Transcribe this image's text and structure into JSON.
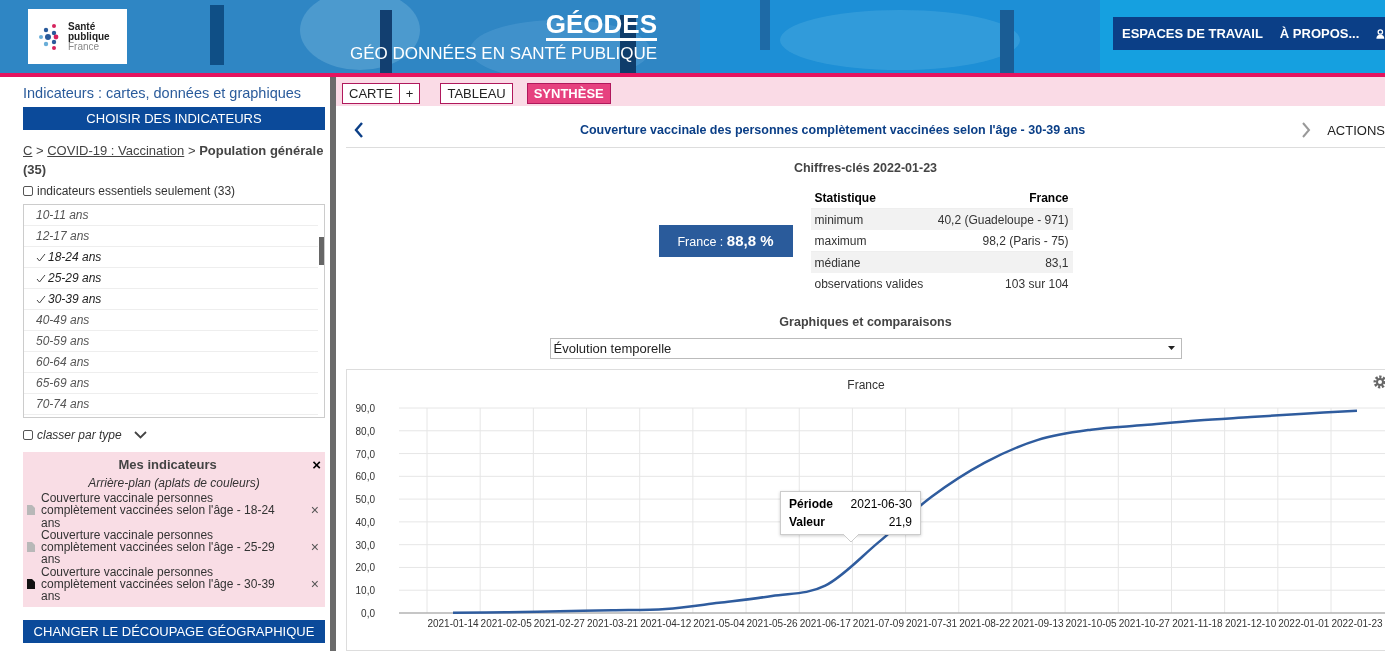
{
  "header": {
    "logo": {
      "line_1": "Santé",
      "line_2": "publique",
      "line_3": "France"
    },
    "title": "GÉODES",
    "subtitle": "GÉO DONNÉES EN SANTÉ PUBLIQUE",
    "nav": [
      "ESPACES DE TRAVAIL",
      "À PROPOS..."
    ],
    "background": {
      "kind": "picture"
    }
  },
  "sidebar": {
    "title": "Indicateurs : cartes, données et graphiques",
    "choose_button": "CHOISIR DES INDICATEURS",
    "breadcrumb": {
      "links": [
        "C",
        "COVID-19 : Vaccination"
      ],
      "separator": ">",
      "current": "Population générale",
      "count": "(35)"
    },
    "essential_filter": {
      "label": "indicateurs essentiels seulement (33)",
      "checked": false
    },
    "items": [
      {
        "label": "10-11 ans",
        "checked": false
      },
      {
        "label": "12-17 ans",
        "checked": false
      },
      {
        "label": "18-24 ans",
        "checked": true
      },
      {
        "label": "25-29 ans",
        "checked": true
      },
      {
        "label": "30-39 ans",
        "checked": true
      },
      {
        "label": "40-49 ans",
        "checked": false
      },
      {
        "label": "50-59 ans",
        "checked": false
      },
      {
        "label": "60-64 ans",
        "checked": false
      },
      {
        "label": "65-69 ans",
        "checked": false
      },
      {
        "label": "70-74 ans",
        "checked": false
      }
    ],
    "sort_by_type": {
      "label": "classer par type",
      "checked": false
    },
    "my_indicators": {
      "title": "Mes indicateurs",
      "close": "×",
      "subtitle": "Arrière-plan (aplats de couleurs)",
      "items": [
        {
          "label": "Couverture vaccinale personnes complètement vaccinées selon l'âge - 18-24 ans",
          "selected": false,
          "remove": "×"
        },
        {
          "label": "Couverture vaccinale personnes complètement vaccinées selon l'âge - 25-29 ans",
          "selected": false,
          "remove": "×"
        },
        {
          "label": "Couverture vaccinale personnes complètement vaccinées selon l'âge - 30-39 ans",
          "selected": true,
          "remove": "×"
        }
      ]
    },
    "change_button": "CHANGER LE DÉCOUPAGE GÉOGRAPHIQUE"
  },
  "tabs": [
    {
      "label": "CARTE",
      "selected": false
    },
    {
      "label": "+",
      "selected": false
    },
    {
      "label": "TABLEAU",
      "selected": false
    },
    {
      "label": "SYNTHÈSE",
      "selected": true
    }
  ],
  "indicator_title": "Couverture vaccinale des personnes complètement vaccinées selon l'âge - 30-39 ans",
  "actions": "ACTIONS",
  "key_figures": {
    "title": "Chiffres-clés 2022-01-23",
    "summary_label": "France : ",
    "summary_value": "88,8 %",
    "columns": [
      "Statistique",
      "France"
    ],
    "rows": [
      [
        "minimum",
        "40,2 (Guadeloupe - 971)"
      ],
      [
        "maximum",
        "98,2 (Paris - 75)"
      ],
      [
        "médiane",
        "83,1"
      ],
      [
        "observations valides",
        "103 sur 104"
      ]
    ]
  },
  "charts_title": "Graphiques et comparaisons",
  "chart_select": {
    "value": "Évolution temporelle"
  },
  "chart": {
    "chart_data": {
      "type": "line",
      "title": "France",
      "categories": [
        "2021-01-14",
        "2021-02-05",
        "2021-02-27",
        "2021-03-21",
        "2021-04-12",
        "2021-05-04",
        "2021-05-26",
        "2021-06-17",
        "2021-07-09",
        "2021-07-31",
        "2021-08-22",
        "2021-09-13",
        "2021-10-05",
        "2021-10-27",
        "2021-11-18",
        "2021-12-10",
        "2022-01-01",
        "2022-01-23"
      ],
      "grid": true,
      "series": [
        {
          "color": "#2f5c9e",
          "values": [
            0.1,
            0.3,
            0.8,
            1.2,
            1.8,
            4.5,
            7.5,
            12,
            31,
            51,
            66,
            76,
            80.5,
            82.5,
            84.5,
            86,
            87.5,
            88.8
          ]
        }
      ],
      "ylim": [
        0,
        90
      ],
      "yticks": [
        {
          "value": 0,
          "label": "0,0"
        },
        {
          "value": 10,
          "label": "10,0"
        },
        {
          "value": 20,
          "label": "20,0"
        },
        {
          "value": 30,
          "label": "30,0"
        },
        {
          "value": 40,
          "label": "40,0"
        },
        {
          "value": 50,
          "label": "50,0"
        },
        {
          "value": 60,
          "label": "60,0"
        },
        {
          "value": 70,
          "label": "70,0"
        },
        {
          "value": 80,
          "label": "80,0"
        },
        {
          "value": 90,
          "label": "90,0"
        }
      ]
    },
    "tooltip": {
      "rows": [
        {
          "label": "Période",
          "value": "2021-06-30"
        },
        {
          "label": "Valeur",
          "value": "21,9"
        }
      ]
    }
  }
}
